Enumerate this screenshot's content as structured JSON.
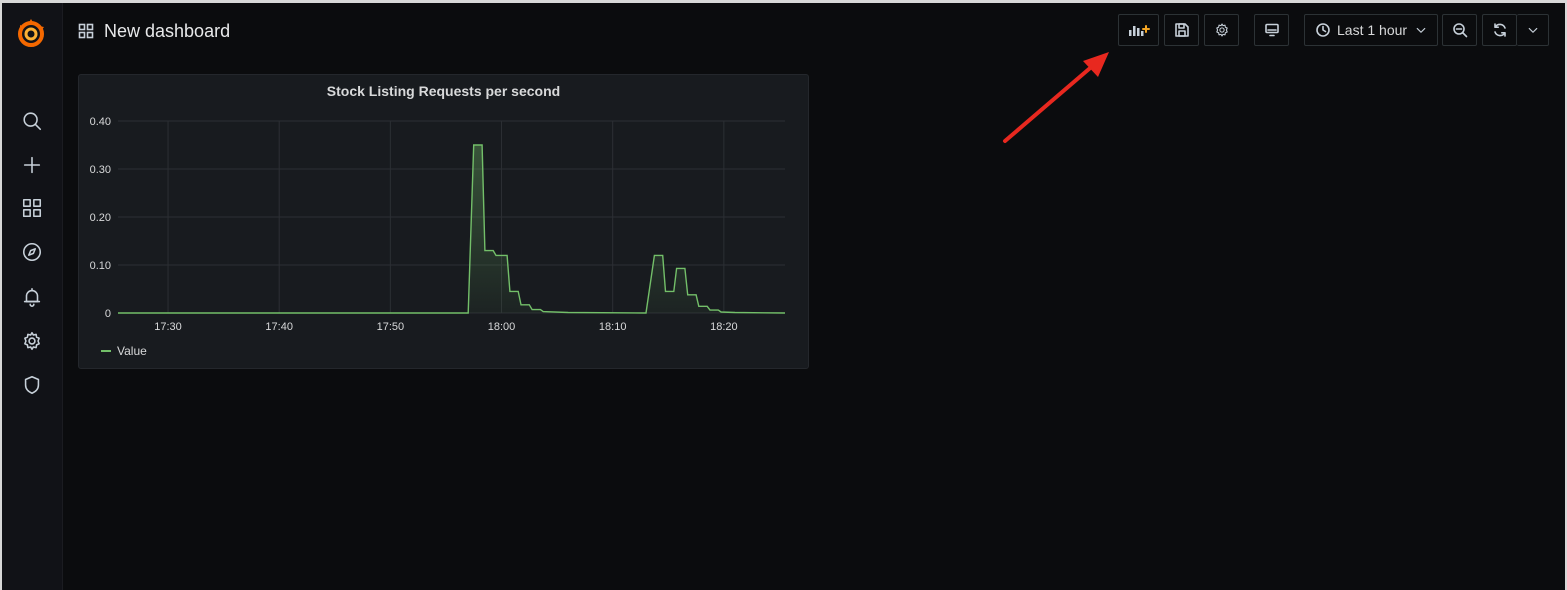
{
  "header": {
    "title": "New dashboard",
    "time_range_label": "Last 1 hour"
  },
  "sidebar": {
    "items": [
      {
        "name": "search",
        "icon": "search-icon"
      },
      {
        "name": "create",
        "icon": "plus-icon"
      },
      {
        "name": "dashboards",
        "icon": "apps-icon"
      },
      {
        "name": "explore",
        "icon": "compass-icon"
      },
      {
        "name": "alerting",
        "icon": "bell-icon"
      },
      {
        "name": "configuration",
        "icon": "gear-icon"
      },
      {
        "name": "server-admin",
        "icon": "shield-icon"
      }
    ]
  },
  "toolbar": {
    "icons": [
      "add-panel-icon",
      "save-icon",
      "settings-icon",
      "tv-monitor-icon",
      "clock-icon",
      "chevron-down-icon",
      "zoom-out-icon",
      "refresh-icon",
      "chevron-down-icon"
    ]
  },
  "colors": {
    "background": "#0b0c0e",
    "panel": "#181b1f",
    "series": "#73bf69",
    "logo": "#f46800",
    "annotation_arrow": "#e8281f"
  },
  "panel": {
    "title": "Stock Listing Requests per second",
    "legend": [
      {
        "label": "Value",
        "color": "#73bf69"
      }
    ]
  },
  "chart_data": {
    "type": "area",
    "title": "Stock Listing Requests per second",
    "xlabel": "",
    "ylabel": "",
    "x_ticks": [
      "17:30",
      "17:40",
      "17:50",
      "18:00",
      "18:10",
      "18:20"
    ],
    "y_ticks": [
      "0",
      "0.10",
      "0.20",
      "0.30",
      "0.40"
    ],
    "ylim": [
      0,
      0.4
    ],
    "xlim": [
      "17:25:30",
      "18:25:30"
    ],
    "grid": true,
    "legend_position": "bottom-left",
    "series": [
      {
        "name": "Value",
        "color": "#73bf69",
        "points": [
          [
            "17:25:30",
            0
          ],
          [
            "17:57:00",
            0
          ],
          [
            "17:57:30",
            0.35
          ],
          [
            "17:58:15",
            0.35
          ],
          [
            "17:58:30",
            0.13
          ],
          [
            "17:59:15",
            0.13
          ],
          [
            "17:59:30",
            0.12
          ],
          [
            "18:00:30",
            0.12
          ],
          [
            "18:00:45",
            0.045
          ],
          [
            "18:01:30",
            0.045
          ],
          [
            "18:01:45",
            0.017
          ],
          [
            "18:02:30",
            0.017
          ],
          [
            "18:02:45",
            0.007
          ],
          [
            "18:03:30",
            0.007
          ],
          [
            "18:03:45",
            0.003
          ],
          [
            "18:06:00",
            0.001
          ],
          [
            "18:13:00",
            0
          ],
          [
            "18:13:45",
            0.12
          ],
          [
            "18:14:30",
            0.12
          ],
          [
            "18:14:45",
            0.045
          ],
          [
            "18:15:30",
            0.045
          ],
          [
            "18:15:45",
            0.093
          ],
          [
            "18:16:30",
            0.093
          ],
          [
            "18:16:45",
            0.038
          ],
          [
            "18:17:30",
            0.038
          ],
          [
            "18:17:45",
            0.014
          ],
          [
            "18:18:30",
            0.014
          ],
          [
            "18:18:45",
            0.006
          ],
          [
            "18:19:30",
            0.006
          ],
          [
            "18:19:45",
            0.002
          ],
          [
            "18:21:00",
            0.001
          ],
          [
            "18:25:30",
            0
          ]
        ]
      }
    ]
  }
}
